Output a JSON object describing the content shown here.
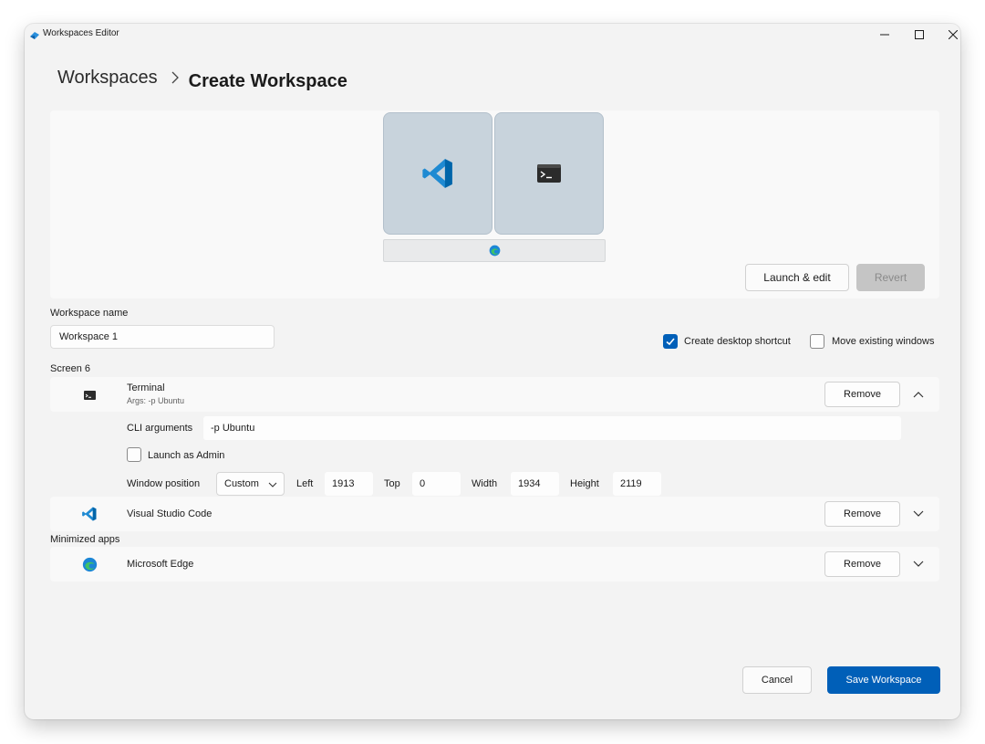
{
  "window": {
    "title": "Workspaces Editor"
  },
  "breadcrumb": {
    "root": "Workspaces",
    "current": "Create Workspace"
  },
  "preview": {
    "tiles": [
      "vscode-icon",
      "terminal-icon"
    ],
    "taskbar_icon": "edge-icon",
    "launch_edit_label": "Launch & edit",
    "revert_label": "Revert"
  },
  "form": {
    "name_label": "Workspace name",
    "name_value": "Workspace 1",
    "create_shortcut_label": "Create desktop shortcut",
    "create_shortcut_checked": true,
    "move_windows_label": "Move existing windows",
    "move_windows_checked": false
  },
  "screen": {
    "label": "Screen 6"
  },
  "apps": [
    {
      "name": "Terminal",
      "args_text": "Args: -p Ubuntu",
      "remove_label": "Remove",
      "expanded": true,
      "cli_label": "CLI arguments",
      "cli_value": "-p Ubuntu",
      "launch_admin_label": "Launch as Admin",
      "launch_admin_checked": false,
      "position_label": "Window position",
      "position_mode": "Custom",
      "left_label": "Left",
      "left_value": "1913",
      "top_label": "Top",
      "top_value": "0",
      "width_label": "Width",
      "width_value": "1934",
      "height_label": "Height",
      "height_value": "2119"
    },
    {
      "name": "Visual Studio Code",
      "remove_label": "Remove",
      "expanded": false
    }
  ],
  "minimized": {
    "label": "Minimized apps",
    "apps": [
      {
        "name": "Microsoft Edge",
        "remove_label": "Remove",
        "expanded": false
      }
    ]
  },
  "footer": {
    "cancel_label": "Cancel",
    "save_label": "Save Workspace"
  },
  "colors": {
    "accent": "#005fb8",
    "tile": "#c8d3dc",
    "vscode_blue": "#1f8ad2"
  }
}
